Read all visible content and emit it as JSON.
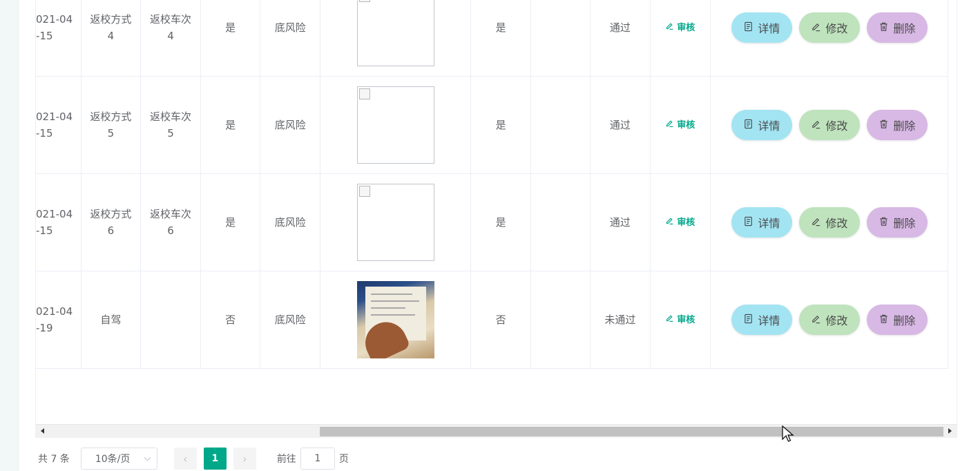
{
  "rows": [
    {
      "date": "",
      "method": "",
      "train": "",
      "flag1": "",
      "risk": "",
      "image": "broken",
      "flag2": "",
      "result": ""
    },
    {
      "date": "021-04\n-15",
      "method": "返校方式\n4",
      "train": "返校车次\n4",
      "flag1": "是",
      "risk": "底风险",
      "image": "broken",
      "flag2": "是",
      "result": "通过"
    },
    {
      "date": "021-04\n-15",
      "method": "返校方式\n5",
      "train": "返校车次\n5",
      "flag1": "是",
      "risk": "底风险",
      "image": "broken",
      "flag2": "是",
      "result": "通过"
    },
    {
      "date": "021-04\n-15",
      "method": "返校方式\n6",
      "train": "返校车次\n6",
      "flag1": "是",
      "risk": "底风险",
      "image": "broken",
      "flag2": "是",
      "result": "通过"
    },
    {
      "date": "021-04\n-19",
      "method": "自驾",
      "train": "",
      "flag1": "否",
      "risk": "底风险",
      "image": "photo",
      "flag2": "否",
      "result": "未通过"
    }
  ],
  "actions": {
    "audit_label": "审核",
    "detail_label": "详情",
    "edit_label": "修改",
    "delete_label": "删除"
  },
  "pagination": {
    "total_text": "共 7 条",
    "page_size_text": "10条/页",
    "current_page": "1",
    "goto_prefix": "前往",
    "goto_value": "1",
    "goto_suffix": "页",
    "prev_icon": "chevron-left-icon",
    "next_icon": "chevron-right-icon"
  },
  "colors": {
    "accent": "#00a88a",
    "detail_button": "#a3e4f3",
    "edit_button": "#bfe3bd",
    "delete_button": "#d8b8e5"
  }
}
